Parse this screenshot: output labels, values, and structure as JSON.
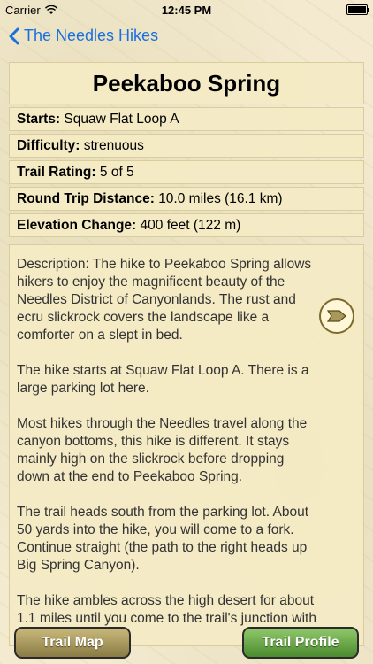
{
  "status_bar": {
    "carrier": "Carrier",
    "time": "12:45 PM"
  },
  "navbar": {
    "back_label": "The Needles Hikes"
  },
  "hike": {
    "title": "Peekaboo Spring",
    "rows": [
      {
        "label": "Starts:",
        "value": "Squaw Flat Loop A"
      },
      {
        "label": "Difficulty:",
        "value": "strenuous"
      },
      {
        "label": "Trail Rating:",
        "value": "5 of 5"
      },
      {
        "label": "Round Trip Distance:",
        "value": "10.0 miles (16.1 km)"
      },
      {
        "label": "Elevation Change:",
        "value": "400 feet (122 m)"
      }
    ],
    "description": [
      "Description: The hike to Peekaboo Spring allows hikers to enjoy the magnificent beauty of the Needles District of Canyonlands. The rust and ecru slickrock covers the landscape like a comforter on a slept in bed.",
      "The hike starts at Squaw Flat Loop A. There is a large parking lot here.",
      "Most hikes through the Needles travel along the canyon bottoms, this hike is different. It stays mainly high on the slickrock before dropping down at the end to Peekaboo Spring.",
      "The trail heads south from the parking lot. About 50 yards into the hike, you will come to a fork. Continue straight (the path to the right heads up Big Spring Canyon).",
      "The hike ambles across the high desert for about 1.1 miles until you come to the trail's junction with"
    ]
  },
  "buttons": {
    "trail_map": "Trail Map",
    "trail_profile": "Trail Profile"
  },
  "colors": {
    "accent": "#1a6fe0",
    "map_button": "#a8985a",
    "profile_button": "#6aa84a"
  }
}
